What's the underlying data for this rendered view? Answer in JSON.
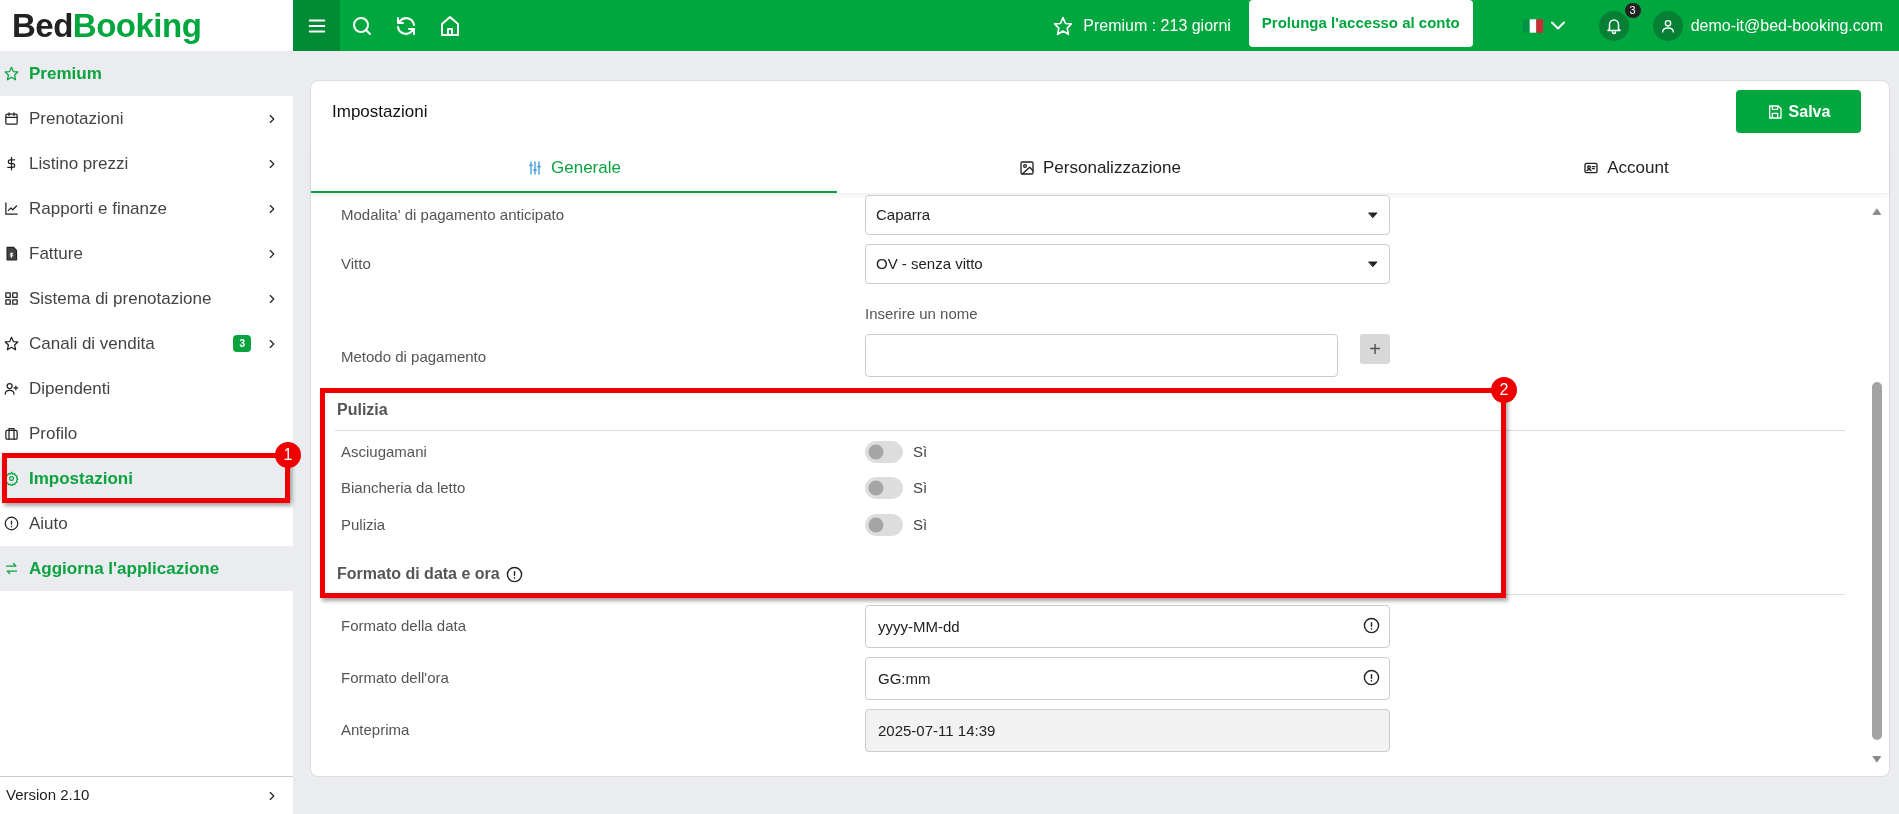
{
  "brand": {
    "dark": "Bed",
    "green": "Booking"
  },
  "topbar": {
    "premium": "Premium : 213 giorni",
    "extend_button": "Prolunga l'accesso al conto",
    "notifications": "3",
    "user": "demo-it@bed-booking.com"
  },
  "sidebar": {
    "items": [
      {
        "label": "Premium",
        "kind": "promo",
        "selected": false,
        "chevron": false
      },
      {
        "label": "Prenotazioni",
        "kind": "link",
        "selected": false,
        "chevron": true
      },
      {
        "label": "Listino prezzi",
        "kind": "link",
        "selected": false,
        "chevron": true
      },
      {
        "label": "Rapporti e finanze",
        "kind": "link",
        "selected": false,
        "chevron": true
      },
      {
        "label": "Fatture",
        "kind": "link",
        "selected": false,
        "chevron": true
      },
      {
        "label": "Sistema di prenotazione",
        "kind": "link",
        "selected": false,
        "chevron": true
      },
      {
        "label": "Canali di vendita",
        "kind": "link",
        "selected": false,
        "chevron": true,
        "badge": "3"
      },
      {
        "label": "Dipendenti",
        "kind": "link",
        "selected": false,
        "chevron": false
      },
      {
        "label": "Profilo",
        "kind": "link",
        "selected": false,
        "chevron": false
      },
      {
        "label": "Impostazioni",
        "kind": "link",
        "selected": true,
        "chevron": false
      },
      {
        "label": "Aiuto",
        "kind": "link",
        "selected": false,
        "chevron": false
      },
      {
        "label": "Aggiorna l'applicazione",
        "kind": "promo",
        "selected": false,
        "chevron": false
      }
    ],
    "version": "Version 2.10"
  },
  "page": {
    "title": "Impostazioni",
    "save_button": "Salva",
    "tabs": [
      {
        "label": "Generale",
        "selected": true
      },
      {
        "label": "Personalizzazione",
        "selected": false
      },
      {
        "label": "Account",
        "selected": false
      }
    ],
    "rows": [
      {
        "kind": "select",
        "label": "Modalita' di pagamento anticipato",
        "value": "Caparra"
      },
      {
        "kind": "select",
        "label": "Vitto",
        "value": "OV - senza vitto"
      },
      {
        "kind": "add-input",
        "label": "Metodo di pagamento",
        "caption": "Inserire un nome",
        "button": "+"
      },
      {
        "kind": "heading",
        "label": "Pulizia",
        "info_icon": false
      },
      {
        "kind": "toggle",
        "label": "Asciugamani",
        "on": false,
        "text": "Sì"
      },
      {
        "kind": "toggle",
        "label": "Biancheria da letto",
        "on": false,
        "text": "Sì"
      },
      {
        "kind": "toggle",
        "label": "Pulizia",
        "on": false,
        "text": "Sì"
      },
      {
        "kind": "heading",
        "label": "Formato di data e ora",
        "info_icon": true
      },
      {
        "kind": "input",
        "label": "Formato della data",
        "value": "yyyy-MM-dd",
        "info_icon": true,
        "disabled": false
      },
      {
        "kind": "input",
        "label": "Formato dell'ora",
        "value": "GG:mm",
        "info_icon": true,
        "disabled": false
      },
      {
        "kind": "input",
        "label": "Anteprima",
        "value": "2025-07-11 14:39",
        "info_icon": false,
        "disabled": true
      }
    ]
  },
  "annotations": [
    {
      "number": "1"
    },
    {
      "number": "2"
    }
  ]
}
